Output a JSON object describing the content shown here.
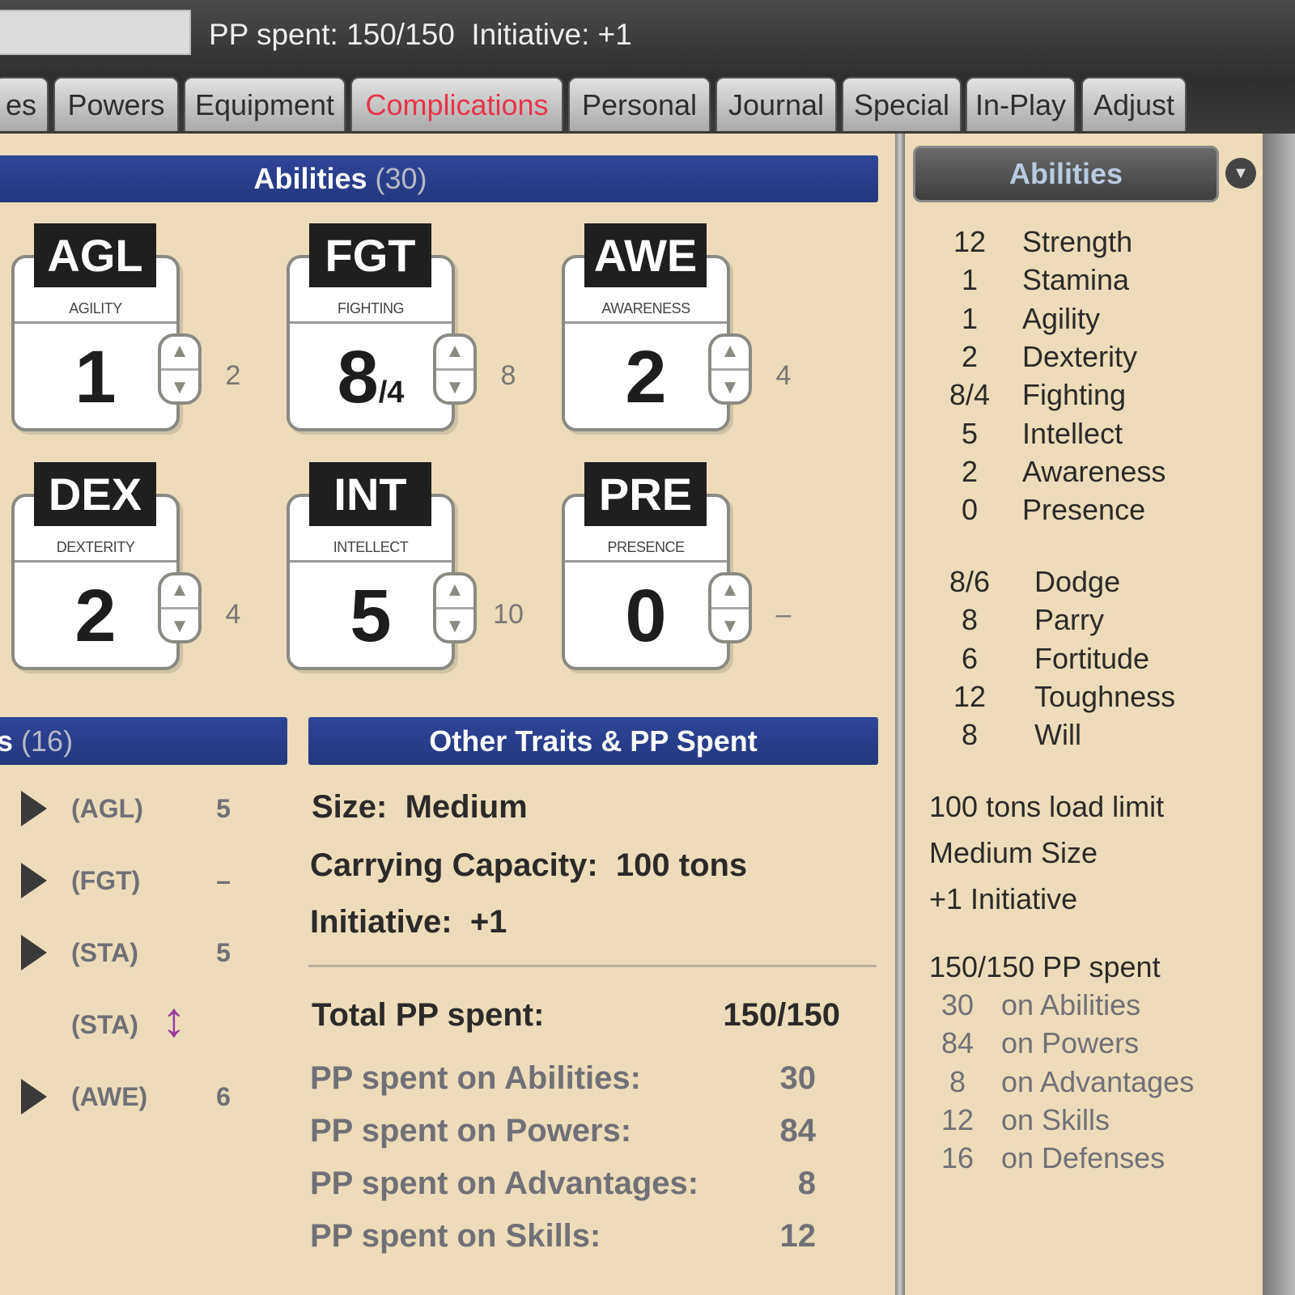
{
  "header": {
    "name_value": "",
    "summary": "PP spent: 150/150  Initiative: +1"
  },
  "tabs": [
    {
      "label": "es",
      "active": false
    },
    {
      "label": "Powers",
      "active": false
    },
    {
      "label": "Equipment",
      "active": false
    },
    {
      "label": "Complications",
      "active": true
    },
    {
      "label": "Personal",
      "active": false
    },
    {
      "label": "Journal",
      "active": false
    },
    {
      "label": "Special",
      "active": false
    },
    {
      "label": "In-Play",
      "active": false
    },
    {
      "label": "Adjust",
      "active": false
    }
  ],
  "abilities_panel": {
    "title": "Abilities",
    "count": "(30)",
    "cards": [
      {
        "abbr": "AGL",
        "name": "AGILITY",
        "value": "1",
        "extra": "",
        "cost": "2"
      },
      {
        "abbr": "FGT",
        "name": "FIGHTING",
        "value": "8",
        "extra": "/4",
        "cost": "8"
      },
      {
        "abbr": "AWE",
        "name": "AWARENESS",
        "value": "2",
        "extra": "",
        "cost": "4"
      },
      {
        "abbr": "DEX",
        "name": "DEXTERITY",
        "value": "2",
        "extra": "",
        "cost": "4"
      },
      {
        "abbr": "INT",
        "name": "INTELLECT",
        "value": "5",
        "extra": "",
        "cost": "10"
      },
      {
        "abbr": "PRE",
        "name": "PRESENCE",
        "value": "0",
        "extra": "",
        "cost": "–"
      }
    ]
  },
  "defenses_panel": {
    "title": "s",
    "count": "(16)",
    "rows": [
      {
        "ability": "(AGL)",
        "value": "5",
        "expander": true
      },
      {
        "ability": "(FGT)",
        "value": "–",
        "expander": true
      },
      {
        "ability": "(STA)",
        "value": "5",
        "expander": true
      },
      {
        "ability": "(STA)",
        "value": "",
        "expander": false,
        "icon": "up-down-arrow-icon"
      },
      {
        "ability": "(AWE)",
        "value": "6",
        "expander": true
      }
    ]
  },
  "other_traits": {
    "title": "Other Traits & PP Spent",
    "size": "Size:  Medium",
    "carrying": "Carrying Capacity:  100 tons",
    "initiative": "Initiative:  +1",
    "total_label": "Total PP spent:",
    "total_value": "150/150",
    "pp_rows": [
      {
        "label": "PP spent on Abilities:",
        "value": "30"
      },
      {
        "label": "PP spent on Powers:",
        "value": "84"
      },
      {
        "label": "PP spent on Advantages:",
        "value": "8"
      },
      {
        "label": "PP spent on Skills:",
        "value": "12"
      }
    ]
  },
  "side": {
    "dropdown": "Abilities",
    "abilities": [
      {
        "v": "12",
        "n": "Strength"
      },
      {
        "v": "1",
        "n": "Stamina"
      },
      {
        "v": "1",
        "n": "Agility"
      },
      {
        "v": "2",
        "n": "Dexterity"
      },
      {
        "v": "8/4",
        "n": "Fighting"
      },
      {
        "v": "5",
        "n": "Intellect"
      },
      {
        "v": "2",
        "n": "Awareness"
      },
      {
        "v": "0",
        "n": "Presence"
      }
    ],
    "defenses": [
      {
        "v": "8/6",
        "n": "Dodge"
      },
      {
        "v": "8",
        "n": "Parry"
      },
      {
        "v": "6",
        "n": "Fortitude"
      },
      {
        "v": "12",
        "n": "Toughness"
      },
      {
        "v": "8",
        "n": "Will"
      }
    ],
    "notes": [
      "100 tons load limit",
      "Medium Size",
      "+1 Initiative"
    ],
    "pp_total": "150/150 PP spent",
    "pp": [
      {
        "v": "30",
        "n": "on Abilities"
      },
      {
        "v": "84",
        "n": "on Powers"
      },
      {
        "v": "8",
        "n": "on Advantages"
      },
      {
        "v": "12",
        "n": "on Skills"
      },
      {
        "v": "16",
        "n": "on Defenses"
      }
    ]
  },
  "colors": {
    "accent_tab": "#e8334a",
    "section_bar": "#2a3f8c",
    "background": "#ecdcb9",
    "ability_icon": "#9b3aa0"
  }
}
